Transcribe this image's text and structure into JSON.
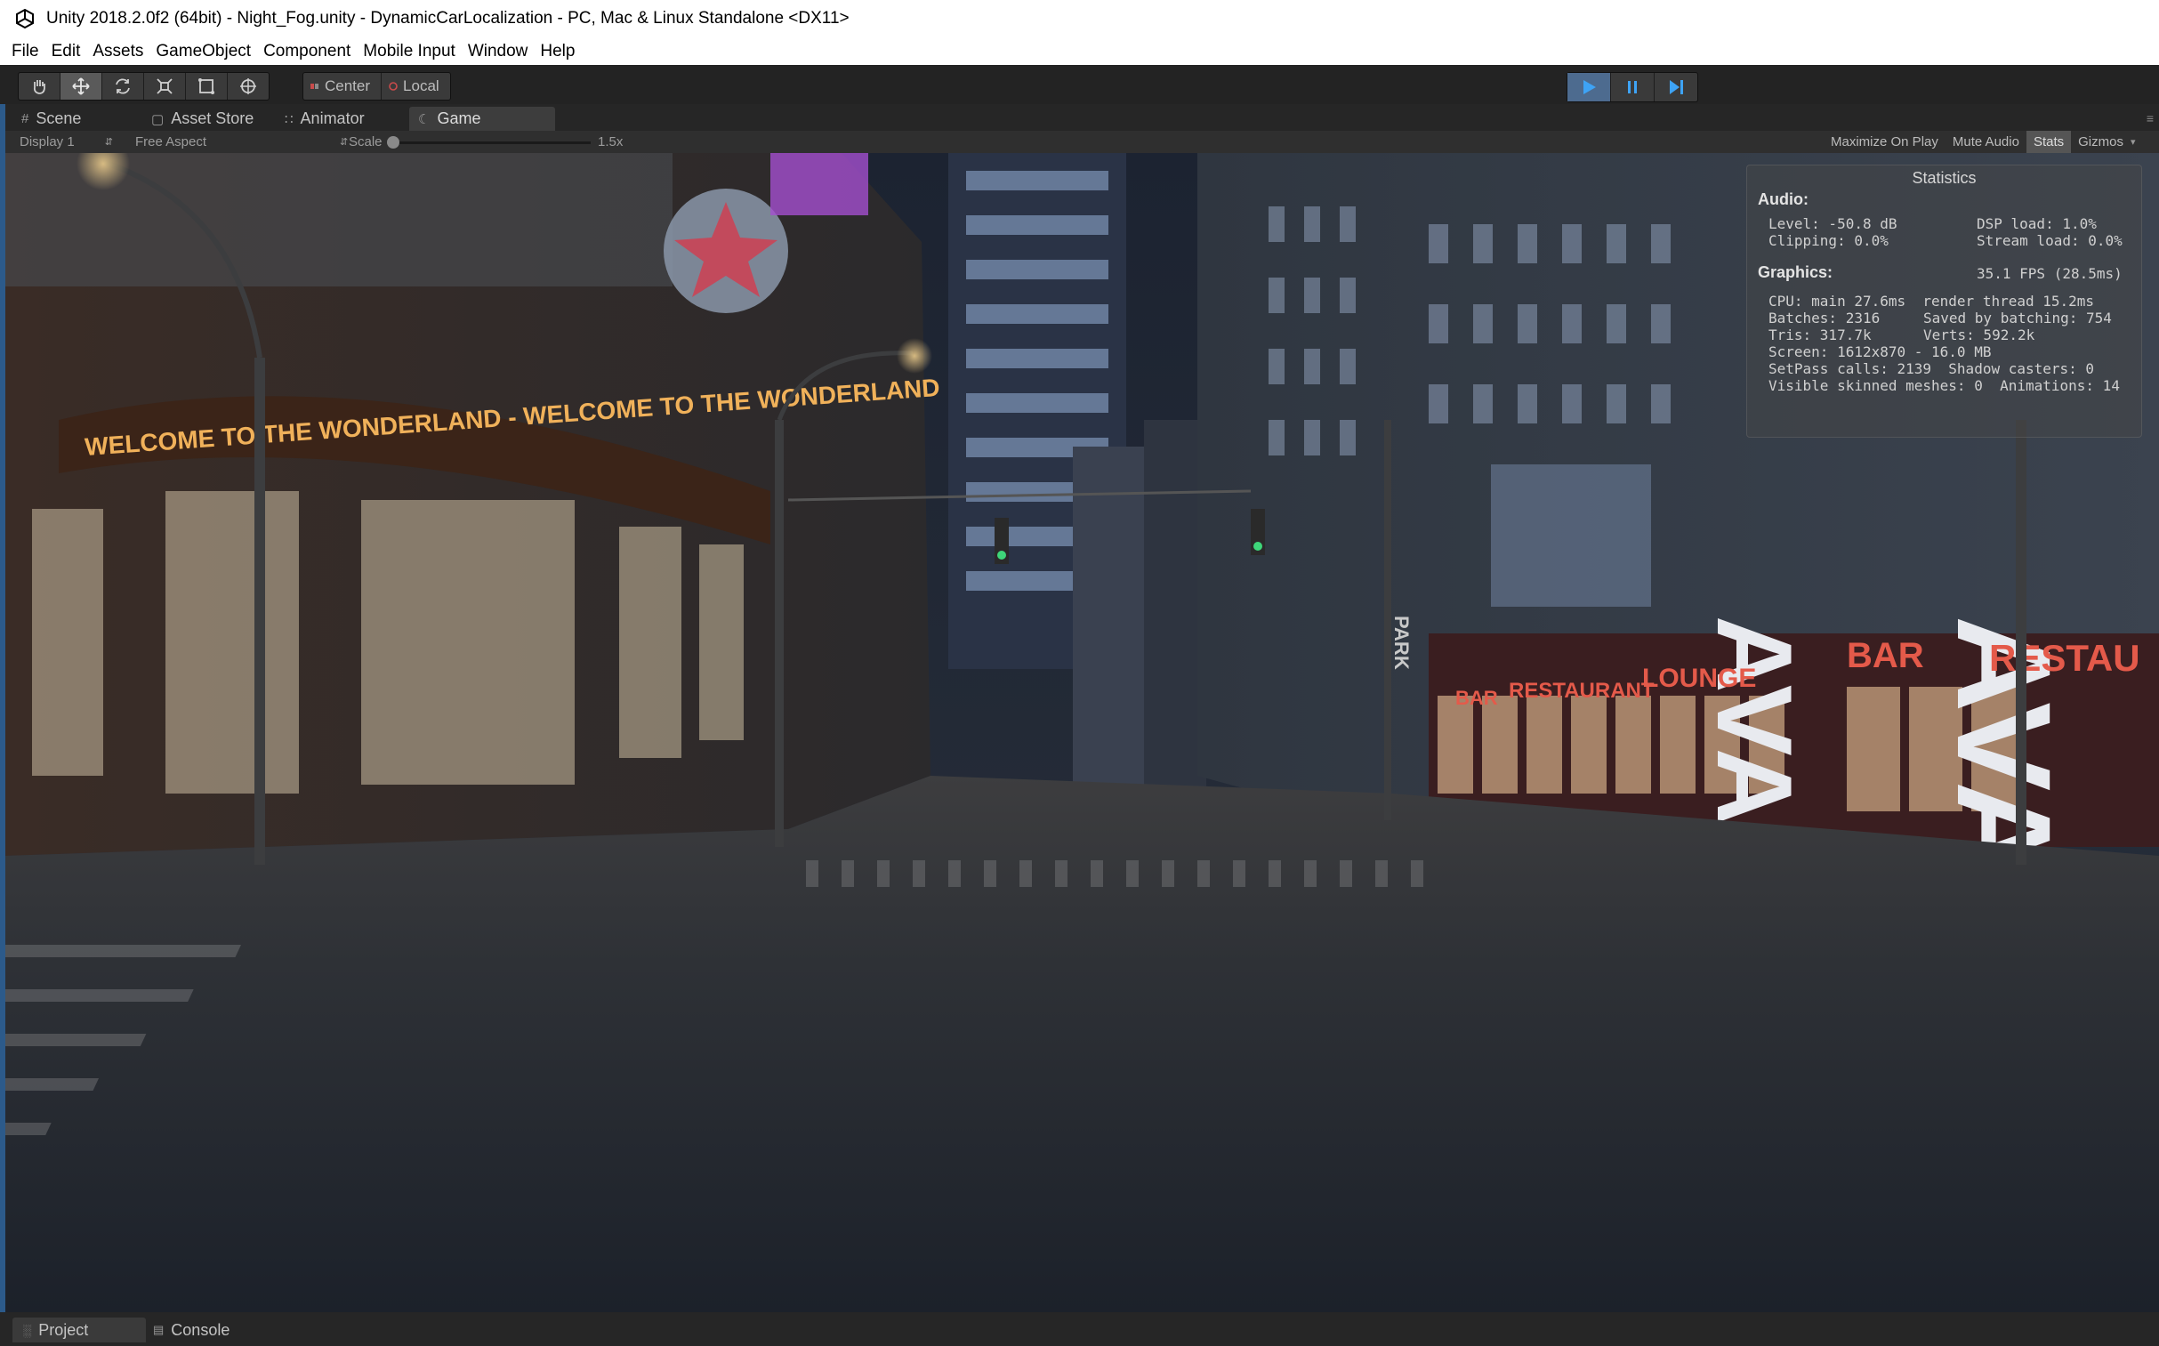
{
  "window": {
    "title": "Unity 2018.2.0f2 (64bit) - Night_Fog.unity - DynamicCarLocalization - PC, Mac & Linux Standalone <DX11>"
  },
  "menu": [
    "File",
    "Edit",
    "Assets",
    "GameObject",
    "Component",
    "Mobile Input",
    "Window",
    "Help"
  ],
  "toolbar": {
    "tools": [
      "hand-tool",
      "move-tool",
      "rotate-tool",
      "scale-tool",
      "rect-tool",
      "transform-tool"
    ],
    "pivot_center": "Center",
    "pivot_local": "Local"
  },
  "tabs": {
    "scene": "Scene",
    "asset_store": "Asset Store",
    "animator": "Animator",
    "game": "Game"
  },
  "game_toolbar": {
    "display": "Display 1",
    "aspect": "Free Aspect",
    "scale_label": "Scale",
    "scale_value": "1.5x",
    "maximize_on_play": "Maximize On Play",
    "mute_audio": "Mute Audio",
    "stats": "Stats",
    "gizmos": "Gizmos"
  },
  "scene_signs": {
    "marquee": "WELCOME TO THE WONDERLAND - WELCOME TO THE WONDERLAND",
    "ava_left": "AVA",
    "ava_right": "AVA",
    "bar_small": "BAR",
    "restaurant": "RESTAURANT",
    "lounge": "LOUNGE",
    "bar_big": "BAR",
    "restau": "RESTAU",
    "park": "PARK"
  },
  "statistics": {
    "title": "Statistics",
    "audio_label": "Audio:",
    "level": "Level: -50.8 dB",
    "dsp": "DSP load: 1.0%",
    "clipping": "Clipping: 0.0%",
    "stream": "Stream load: 0.0%",
    "graphics_label": "Graphics:",
    "fps": "35.1 FPS (28.5ms)",
    "cpu": "CPU: main 27.6ms  render thread 15.2ms",
    "batches": "Batches: 2316",
    "saved": "Saved by batching: 754",
    "tris": "Tris: 317.7k",
    "verts": "Verts: 592.2k",
    "screen": "Screen: 1612x870 - 16.0 MB",
    "setpass": "SetPass calls: 2139  Shadow casters: 0",
    "skinned": "Visible skinned meshes: 0  Animations: 14"
  },
  "bottom_tabs": {
    "project": "Project",
    "console": "Console"
  }
}
